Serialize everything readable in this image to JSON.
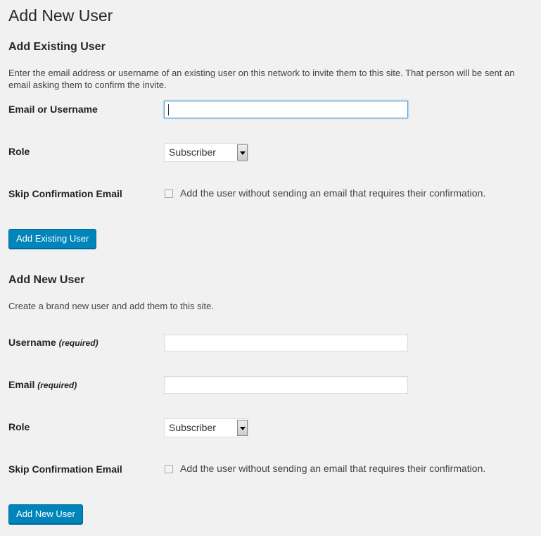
{
  "page_title": "Add New User",
  "existing": {
    "heading": "Add Existing User",
    "description": "Enter the email address or username of an existing user on this network to invite them to this site. That person will be sent an email asking them to confirm the invite.",
    "email_label": "Email or Username",
    "email_value": "",
    "role_label": "Role",
    "role_value": "Subscriber",
    "skip_label": "Skip Confirmation Email",
    "skip_text": "Add the user without sending an email that requires their confirmation.",
    "skip_checked": false,
    "button": "Add Existing User"
  },
  "new": {
    "heading": "Add New User",
    "description": "Create a brand new user and add them to this site.",
    "username_label": "Username",
    "email_label": "Email",
    "required": "(required)",
    "role_label": "Role",
    "role_value": "Subscriber",
    "skip_label": "Skip Confirmation Email",
    "skip_text": "Add the user without sending an email that requires their confirmation.",
    "skip_checked": false,
    "button": "Add New User"
  }
}
